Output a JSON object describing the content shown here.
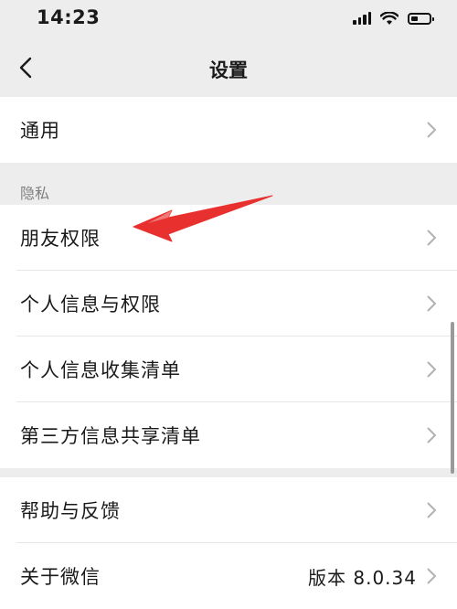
{
  "status_bar": {
    "time": "14:23",
    "icons": [
      "signal-icon",
      "wifi-icon",
      "battery-icon"
    ]
  },
  "nav": {
    "title": "设置",
    "back_icon": "chevron-left-icon"
  },
  "groups": {
    "general": {
      "label": "通用"
    },
    "privacy": {
      "header": "隐私",
      "items": [
        {
          "label": "朋友权限"
        },
        {
          "label": "个人信息与权限"
        },
        {
          "label": "个人信息收集清单"
        },
        {
          "label": "第三方信息共享清单"
        }
      ]
    },
    "about": {
      "items": [
        {
          "label": "帮助与反馈"
        },
        {
          "label": "关于微信",
          "value": "版本 8.0.34"
        }
      ]
    }
  },
  "annotation": {
    "color": "#e8312f",
    "icon": "red-arrow-pointer"
  }
}
